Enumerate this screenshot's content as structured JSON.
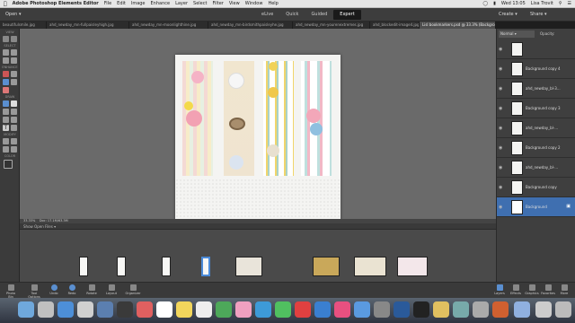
{
  "menubar": {
    "apple": "",
    "items": [
      "Adobe Photoshop Elements Editor",
      "File",
      "Edit",
      "Image",
      "Enhance",
      "Layer",
      "Select",
      "Filter",
      "View",
      "Window",
      "Help"
    ],
    "clock": "Wed 13:05",
    "user": "Lisa Trovit"
  },
  "toolbar": {
    "open_label": "Open",
    "modes": [
      "eLive",
      "Quick",
      "Guided",
      "Expert"
    ],
    "active_mode": "Expert",
    "create_label": "Create",
    "share_label": "Share"
  },
  "tabs": [
    "beautifulsmile.jpg",
    "ahd_newday_mn-fullpaisleyhigh.jpg",
    "ahd_newday_mn-moonlighthine.jpg",
    "ahd_newday_mn-birdsmithpaisleyhe.jpg",
    "ahd_newday_mn-yourenextremes.jpg",
    "ahd_blockedit-image4.jpg",
    "Lisl bookmarkers.psd @ 33.3% (Background, RGB/8)"
  ],
  "left_panel": {
    "labels": [
      "VIEW",
      "SELECT",
      "ENHANCE",
      "DRAW",
      "MODIFY",
      "COLOR"
    ]
  },
  "statusbar": {
    "zoom": "33.33%",
    "doc": "Doc: 17.1M/63.3M"
  },
  "photo_bin": {
    "dropdown": "Show Open Files"
  },
  "bottom_bar": {
    "left": [
      "Photo Bin",
      "Tool Options",
      "Undo",
      "Redo",
      "Rotate",
      "Layout",
      "Organizer"
    ],
    "right": [
      "Layers",
      "Effects",
      "Graphics",
      "Favorites",
      "More"
    ]
  },
  "layers_panel": {
    "mode": "Normal",
    "opacity_label": "Opacity:",
    "layers": [
      {
        "name": "",
        "selected": false
      },
      {
        "name": "Background copy 4",
        "selected": false
      },
      {
        "name": "ahd_newday_bl-3...",
        "selected": false
      },
      {
        "name": "Background copy 3",
        "selected": false
      },
      {
        "name": "ahd_newday_bl-...",
        "selected": false
      },
      {
        "name": "Background copy 2",
        "selected": false
      },
      {
        "name": "ahd_newday_bl-...",
        "selected": false
      },
      {
        "name": "Background copy",
        "selected": false
      },
      {
        "name": "Background",
        "selected": true
      }
    ]
  },
  "colors": {
    "accent": "#3f6fb0",
    "app_bg": "#6a6a6a",
    "panel_bg": "#3b3b3b"
  }
}
